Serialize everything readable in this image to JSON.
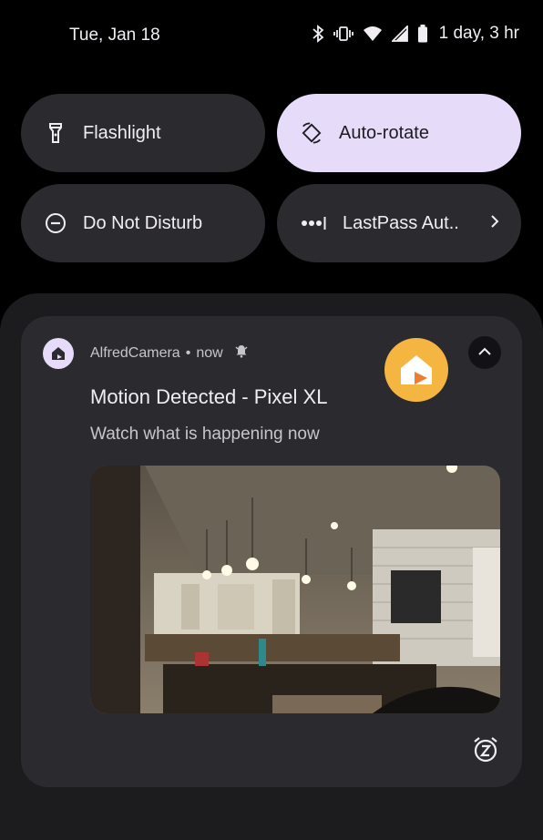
{
  "status_bar": {
    "date": "Tue, Jan 18",
    "battery_text": "1 day, 3 hr",
    "icons": [
      "bluetooth-icon",
      "vibrate-icon",
      "wifi-icon",
      "cell-signal-icon",
      "battery-icon"
    ]
  },
  "quick_tiles": [
    {
      "label": "Flashlight",
      "icon": "flashlight-icon",
      "active": false
    },
    {
      "label": "Auto-rotate",
      "icon": "auto-rotate-icon",
      "active": true
    },
    {
      "label": "Do Not Disturb",
      "icon": "do-not-disturb-icon",
      "active": false
    },
    {
      "label": "LastPass Aut..",
      "icon": "lastpass-icon",
      "active": false,
      "has_chevron": true
    }
  ],
  "notification": {
    "app_name": "AlfredCamera",
    "separator": "•",
    "time": "now",
    "title": "Motion Detected - Pixel XL",
    "text": "Watch what is happening now",
    "image_description_icon": "kitchen-photo",
    "actions": [
      "expand-collapse-icon",
      "snooze-icon"
    ]
  },
  "colors": {
    "background": "#000000",
    "tile": "#2b2b2f",
    "tile_active": "#e6dcfa",
    "shade": "#1c1c1f",
    "notification": "#2b2b2f",
    "app_large_icon": "#f5b541"
  }
}
